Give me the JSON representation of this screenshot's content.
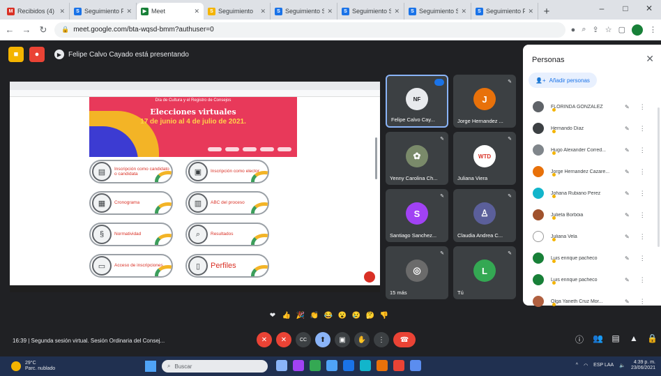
{
  "browser": {
    "tabs": [
      {
        "title": "Recibidos (4)",
        "fav": "M",
        "color": "#d93025"
      },
      {
        "title": "Seguimiento PI",
        "fav": "S",
        "color": "#1a73e8"
      },
      {
        "title": "Meet",
        "fav": "▶",
        "color": "#188038",
        "active": true
      },
      {
        "title": "Seguimiento",
        "fav": "S",
        "color": "#f4b400"
      },
      {
        "title": "Seguimiento Sol",
        "fav": "S",
        "color": "#1a73e8"
      },
      {
        "title": "Seguimiento Sol",
        "fav": "S",
        "color": "#1a73e8"
      },
      {
        "title": "Seguimiento Sol",
        "fav": "S",
        "color": "#1a73e8"
      },
      {
        "title": "Seguimiento PI",
        "fav": "S",
        "color": "#1a73e8"
      }
    ],
    "new_tab": "+",
    "url": "meet.google.com/bta-wqsd-bmm?authuser=0",
    "window_min": "–",
    "window_max": "□",
    "window_close": "✕"
  },
  "meet": {
    "presenting_text": "Felipe Calvo Cayado está presentando",
    "meeting_info": "16:39  |  Segunda sesión virtual. Sesión Ordinaria del Consej..."
  },
  "slide": {
    "top_text": "Día de Cultura y el Registro de Consejos",
    "title": "Elecciones virtuales",
    "subtitle": "17 de junio al 4 de julio de 2021.",
    "buttons": [
      {
        "label": "Inscripción como candidato o candidata",
        "icon": "▤",
        "big": false
      },
      {
        "label": "Inscripción como elector",
        "icon": "▣",
        "big": false
      },
      {
        "label": "Cronograma",
        "icon": "▦",
        "big": false
      },
      {
        "label": "ABC del proceso",
        "icon": "▥",
        "big": false
      },
      {
        "label": "Normatividad",
        "icon": "§",
        "big": false
      },
      {
        "label": "Resultados",
        "icon": "⌕",
        "big": false
      },
      {
        "label": "Acceso de inscripciones",
        "icon": "▭",
        "big": false
      },
      {
        "label": "Perfiles",
        "icon": "▯",
        "big": true
      }
    ]
  },
  "tiles": [
    {
      "name": "Felipe Calvo Cay...",
      "initial": "NF",
      "color": "#e8eaed",
      "text_color": "#202124",
      "highlight": true
    },
    {
      "name": "Jorge Hernandez ...",
      "initial": "J",
      "color": "#e8710a",
      "text_color": "#ffffff",
      "highlight": false
    },
    {
      "name": "Yenny Carolina Ch...",
      "initial": "✿",
      "color": "#7a8a6a",
      "text_color": "#ffffff",
      "highlight": false
    },
    {
      "name": "Juliana Viera",
      "initial": "WTD",
      "color": "#ffffff",
      "text_color": "#d93025",
      "highlight": false
    },
    {
      "name": "Santiago Sanchez...",
      "initial": "S",
      "color": "#a142f4",
      "text_color": "#ffffff",
      "highlight": false
    },
    {
      "name": "Claudia Andrea C...",
      "initial": "♙",
      "color": "#5b5f9a",
      "text_color": "#ffffff",
      "highlight": false
    },
    {
      "name": "15 más",
      "initial": "◎",
      "color": "#6b6b6b",
      "text_color": "#ffffff",
      "highlight": false
    },
    {
      "name": "Tú",
      "initial": "L",
      "color": "#34a853",
      "text_color": "#ffffff",
      "highlight": false
    }
  ],
  "people_panel": {
    "title": "Personas",
    "add_label": "Añadir personas",
    "close": "✕",
    "people": [
      {
        "name": "FLORINDA GONZALEZ",
        "color": "#5f6368"
      },
      {
        "name": "Hernando Díaz",
        "color": "#3c4043"
      },
      {
        "name": "Hugo Alexander Corred...",
        "color": "#80868b"
      },
      {
        "name": "Jorge Hernandez Cazare...",
        "color": "#e8710a"
      },
      {
        "name": "Johana Rubiano Perez",
        "color": "#12b5cb"
      },
      {
        "name": "Julieta Borbóia",
        "color": "#a0522d"
      },
      {
        "name": "Juliana Vela",
        "color": "#ffffff"
      },
      {
        "name": "Luis enrique pacheco",
        "color": "#188038"
      },
      {
        "name": "Luis enrique pacheco",
        "color": "#188038"
      },
      {
        "name": "Olga Yaneth Cruz Mor...",
        "color": "#b06040"
      }
    ]
  },
  "reactions": [
    "❤",
    "👍",
    "🎉",
    "👏",
    "😂",
    "😮",
    "😢",
    "🤔",
    "👎"
  ],
  "controls": {
    "mic": "✕",
    "cam": "✕",
    "captions": "CC",
    "present": "⬆",
    "screen": "▣",
    "hand": "✋",
    "more": "⋮",
    "end": "☎"
  },
  "right_controls": {
    "info": "ⓘ",
    "people": "👥",
    "chat": "▤",
    "activities": "▲",
    "lock": "🔒"
  },
  "taskbar": {
    "weather_temp": "29°C",
    "weather_desc": "Parc. nublado",
    "search": "Buscar",
    "lang": "ESP LAA",
    "time": "4:39 p. m.",
    "date": "23/06/2021"
  }
}
